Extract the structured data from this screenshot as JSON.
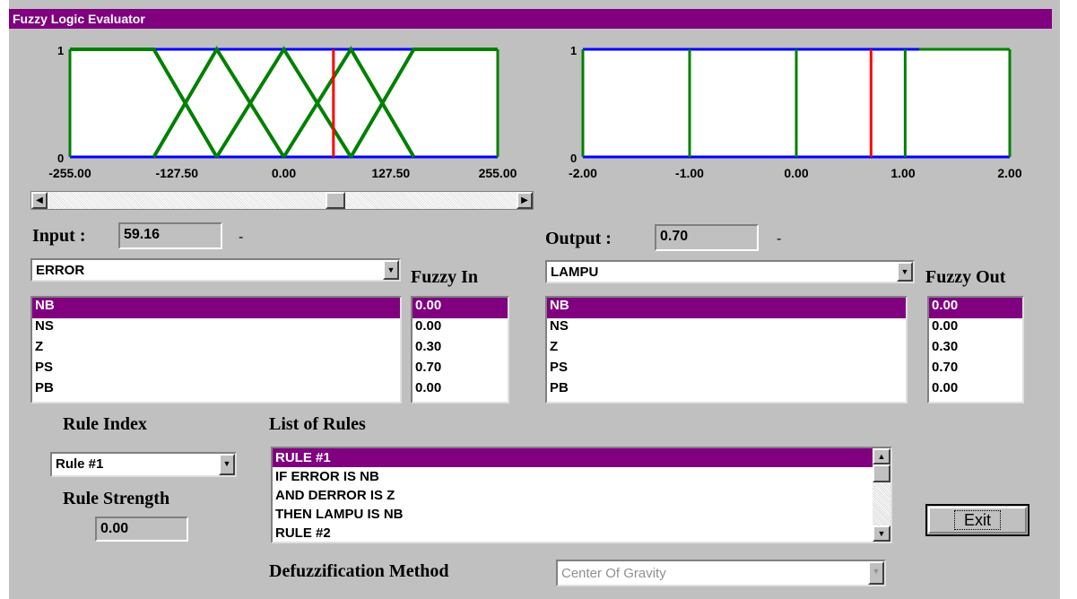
{
  "window": {
    "title": "Fuzzy Logic Evaluator"
  },
  "input_chart": {
    "ytick_top": "1",
    "ytick_bottom": "0",
    "xticks": [
      "-255.00",
      "-127.50",
      "0.00",
      "127.50",
      "255.00"
    ],
    "xmin": -255,
    "xmax": 255,
    "marker": 59.16,
    "sets": [
      {
        "name": "NB",
        "points": [
          [
            -255,
            1
          ],
          [
            -155,
            1
          ],
          [
            -80,
            0
          ]
        ]
      },
      {
        "name": "NS",
        "points": [
          [
            -155,
            0
          ],
          [
            -80,
            1
          ],
          [
            0,
            0
          ]
        ]
      },
      {
        "name": "Z",
        "points": [
          [
            -80,
            0
          ],
          [
            0,
            1
          ],
          [
            80,
            0
          ]
        ]
      },
      {
        "name": "PS",
        "points": [
          [
            0,
            0
          ],
          [
            80,
            1
          ],
          [
            155,
            0
          ]
        ]
      },
      {
        "name": "PB",
        "points": [
          [
            80,
            0
          ],
          [
            155,
            1
          ],
          [
            255,
            1
          ]
        ]
      }
    ],
    "colors": {
      "sets": "#008000",
      "marker": "#ff0000",
      "axis": "#0000ff"
    }
  },
  "output_chart": {
    "ytick_top": "1",
    "ytick_bottom": "0",
    "xticks": [
      "-2.00",
      "-1.00",
      "0.00",
      "1.00",
      "2.00"
    ],
    "xmin": -2,
    "xmax": 2,
    "marker": 0.7,
    "singletons": [
      -2,
      -1,
      0,
      1,
      2
    ],
    "colors": {
      "sets": "#008000",
      "marker": "#ff0000",
      "axis": "#0000ff"
    }
  },
  "slider": {
    "value_percent": 61.6
  },
  "input": {
    "label": "Input :",
    "value": "59.16",
    "dash": "-"
  },
  "output": {
    "label": "Output :",
    "value": "0.70",
    "dash": "-"
  },
  "input_var": {
    "selected": "ERROR"
  },
  "output_var": {
    "selected": "LAMPU"
  },
  "fuzzy_in": {
    "label": "Fuzzy In"
  },
  "fuzzy_out": {
    "label": "Fuzzy Out"
  },
  "input_sets": [
    "NB",
    "NS",
    "Z",
    "PS",
    "PB"
  ],
  "input_values": [
    "0.00",
    "0.00",
    "0.30",
    "0.70",
    "0.00"
  ],
  "output_sets": [
    "NB",
    "NS",
    "Z",
    "PS",
    "PB"
  ],
  "output_values": [
    "0.00",
    "0.00",
    "0.30",
    "0.70",
    "0.00"
  ],
  "rule_index": {
    "label": "Rule Index",
    "selected": "Rule #1"
  },
  "rule_strength": {
    "label": "Rule Strength",
    "value": "0.00"
  },
  "rules": {
    "label": "List of Rules",
    "lines": [
      "RULE #1",
      "IF ERROR IS NB",
      "AND DERROR IS Z",
      "THEN LAMPU IS NB",
      "RULE #2"
    ]
  },
  "defuzz": {
    "label": "Defuzzification Method",
    "selected": "Center Of Gravity"
  },
  "exit_button": {
    "label": "Exit"
  }
}
